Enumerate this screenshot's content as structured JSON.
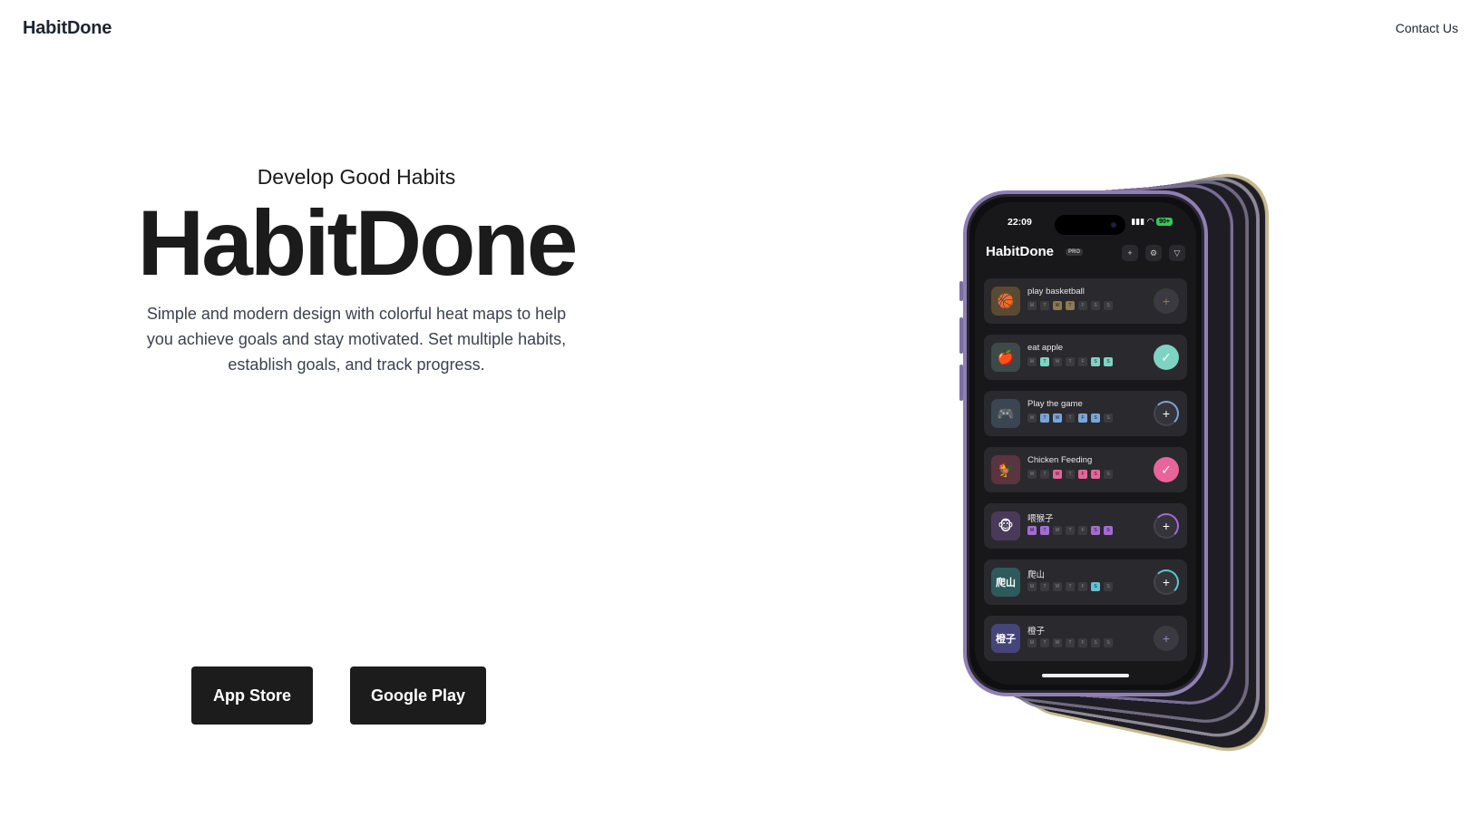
{
  "nav": {
    "brand": "HabitDone",
    "contact": "Contact Us"
  },
  "hero": {
    "eyebrow": "Develop Good Habits",
    "headline": "HabitDone",
    "description": "Simple and modern design with colorful heat maps to help you achieve goals and stay motivated. Set multiple habits, establish goals, and track progress."
  },
  "cta": {
    "app_store": "App Store",
    "google_play": "Google Play"
  },
  "phone": {
    "status_time": "22:09",
    "battery": "90+",
    "app_title": "HabitDone",
    "pro_badge": "PRO",
    "header_icons": [
      "plus-icon",
      "gear-icon",
      "filter-icon"
    ],
    "day_letters": [
      "M",
      "T",
      "W",
      "T",
      "F",
      "S",
      "S"
    ],
    "habits": [
      {
        "name": "play basketball",
        "icon": "🏀",
        "icon_bg": "#5a4a33",
        "accent": "#8a7a55",
        "action": "plus",
        "filled": [
          false,
          false,
          true,
          true,
          false,
          false,
          false
        ]
      },
      {
        "name": "eat apple",
        "icon": "🍎",
        "icon_bg": "#3c4a4a",
        "accent": "#7fd3c2",
        "action": "check",
        "filled": [
          false,
          true,
          false,
          false,
          false,
          true,
          true
        ]
      },
      {
        "name": "Play the game",
        "icon": "🎮",
        "icon_bg": "#3a4652",
        "accent": "#7aa6d6",
        "action": "ring",
        "filled": [
          false,
          true,
          true,
          false,
          true,
          true,
          false
        ]
      },
      {
        "name": "Chicken Feeding",
        "icon": "🐓",
        "icon_bg": "#5a3440",
        "accent": "#e8649a",
        "action": "check",
        "filled": [
          false,
          false,
          true,
          false,
          true,
          true,
          false
        ]
      },
      {
        "name": "喂猴子",
        "icon": "🐵",
        "icon_bg": "#4a3a5a",
        "accent": "#a46ad6",
        "action": "ring",
        "filled": [
          true,
          true,
          false,
          false,
          false,
          true,
          true
        ]
      },
      {
        "name": "爬山",
        "icon": "爬山",
        "icon_bg": "#2d5a5c",
        "accent": "#5cc6d6",
        "action": "ring",
        "filled": [
          false,
          false,
          false,
          false,
          false,
          true,
          false
        ]
      },
      {
        "name": "橙子",
        "icon": "橙子",
        "icon_bg": "#46457a",
        "accent": "#8a88d6",
        "action": "plus",
        "filled": [
          false,
          false,
          false,
          false,
          false,
          false,
          false
        ]
      }
    ]
  }
}
